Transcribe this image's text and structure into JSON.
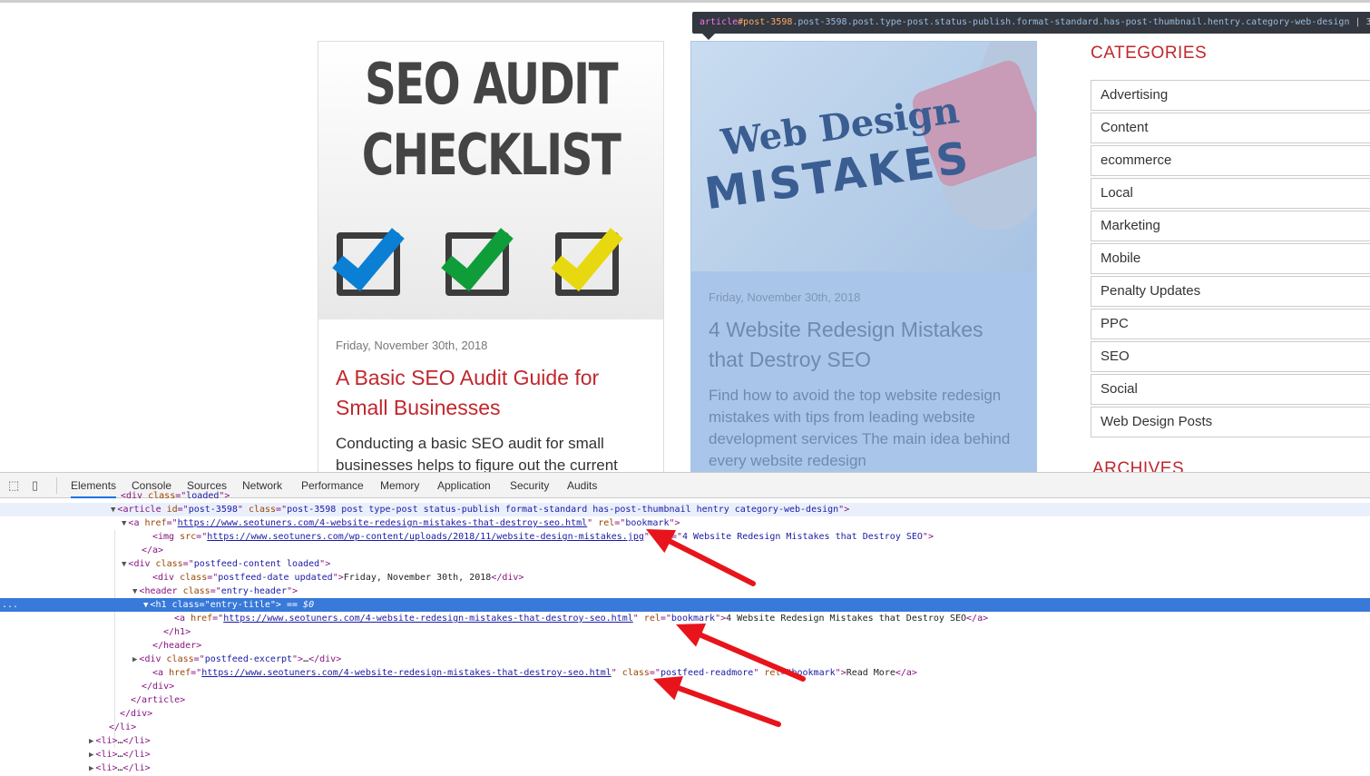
{
  "tooltip": {
    "tag": "article",
    "id": "#post-3598",
    "classes": ".post-3598.post.type-post.status-publish.format-standard.has-post-thumbnail.hentry.category-web-design",
    "extra": "| 3"
  },
  "cards": [
    {
      "image_text": [
        "SEO AUDIT",
        "CHECKLIST"
      ],
      "checkbox_colors": [
        "#0a7fd4",
        "#0f9d3a",
        "#e8d80f"
      ],
      "date": "Friday, November 30th, 2018",
      "title": "A Basic SEO Audit Guide for Small Businesses",
      "excerpt": "Conducting a basic SEO audit for small businesses helps to figure out the current"
    },
    {
      "image_text": [
        "Web Design",
        "MISTAKES"
      ],
      "date": "Friday, November 30th, 2018",
      "title": "4 Website Redesign Mistakes that Destroy SEO",
      "excerpt": "Find how to avoid the top website redesign mistakes with tips from leading website development services The main idea behind every website redesign",
      "highlighted": true
    }
  ],
  "sidebar": {
    "categories_title": "CATEGORIES",
    "categories": [
      "Advertising",
      "Content",
      "ecommerce",
      "Local",
      "Marketing",
      "Mobile",
      "Penalty Updates",
      "PPC",
      "SEO",
      "Social",
      "Web Design Posts"
    ],
    "archives_title": "ARCHIVES"
  },
  "devtools": {
    "tabs": [
      "Elements",
      "Console",
      "Sources",
      "Network",
      "Performance",
      "Memory",
      "Application",
      "Security",
      "Audits"
    ],
    "active_tab": "Elements",
    "selected_marker": "...",
    "lines": [
      {
        "indent": 122,
        "tokens": [
          [
            "tg",
            "<div "
          ],
          [
            "at",
            "class"
          ],
          [
            "tg",
            "=\""
          ],
          [
            "vl",
            "loaded"
          ],
          [
            "tg",
            "\">"
          ]
        ]
      },
      {
        "indent": 122,
        "tri": "▼",
        "hover": true,
        "tokens": [
          [
            "tg",
            "<article "
          ],
          [
            "at",
            "id"
          ],
          [
            "tg",
            "=\""
          ],
          [
            "vl",
            "post-3598"
          ],
          [
            "tg",
            "\" "
          ],
          [
            "at",
            "class"
          ],
          [
            "tg",
            "=\""
          ],
          [
            "vl",
            "post-3598 post type-post status-publish format-standard has-post-thumbnail hentry category-web-design"
          ],
          [
            "tg",
            "\">"
          ]
        ]
      },
      {
        "indent": 134,
        "tri": "▼",
        "tokens": [
          [
            "tg",
            "<a "
          ],
          [
            "at",
            "href"
          ],
          [
            "tg",
            "=\""
          ],
          [
            "lk",
            "https://www.seotuners.com/4-website-redesign-mistakes-that-destroy-seo.html"
          ],
          [
            "tg",
            "\" "
          ],
          [
            "at",
            "rel"
          ],
          [
            "tg",
            "=\""
          ],
          [
            "vl",
            "bookmark"
          ],
          [
            "tg",
            "\">"
          ]
        ]
      },
      {
        "indent": 157,
        "tokens": [
          [
            "tg",
            "<img "
          ],
          [
            "at",
            "src"
          ],
          [
            "tg",
            "=\""
          ],
          [
            "lk",
            "https://www.seotuners.com/wp-content/uploads/2018/11/website-design-mistakes.jpg"
          ],
          [
            "tg",
            "\" "
          ],
          [
            "at",
            "alt"
          ],
          [
            "tg",
            "=\""
          ],
          [
            "vl",
            "4 Website Redesign Mistakes that Destroy SEO"
          ],
          [
            "tg",
            "\">"
          ]
        ]
      },
      {
        "indent": 145,
        "tokens": [
          [
            "tg",
            "</a>"
          ]
        ]
      },
      {
        "indent": 134,
        "tri": "▼",
        "tokens": [
          [
            "tg",
            "<div "
          ],
          [
            "at",
            "class"
          ],
          [
            "tg",
            "=\""
          ],
          [
            "vl",
            "postfeed-content loaded"
          ],
          [
            "tg",
            "\">"
          ]
        ]
      },
      {
        "indent": 157,
        "tokens": [
          [
            "tg",
            "<div "
          ],
          [
            "at",
            "class"
          ],
          [
            "tg",
            "=\""
          ],
          [
            "vl",
            "postfeed-date updated"
          ],
          [
            "tg",
            "\">"
          ],
          [
            "tx",
            "Friday, November 30th, 2018"
          ],
          [
            "tg",
            "</div>"
          ]
        ]
      },
      {
        "indent": 146,
        "tri": "▼",
        "tokens": [
          [
            "tg",
            "<header "
          ],
          [
            "at",
            "class"
          ],
          [
            "tg",
            "=\""
          ],
          [
            "vl",
            "entry-header"
          ],
          [
            "tg",
            "\">"
          ]
        ]
      },
      {
        "indent": 158,
        "tri": "▼",
        "selected": true,
        "tokens": [
          [
            "tg",
            "<h1 "
          ],
          [
            "at",
            "class"
          ],
          [
            "tg",
            "=\""
          ],
          [
            "vl",
            "entry-title"
          ],
          [
            "tg",
            "\">"
          ],
          [
            "tx",
            " == "
          ],
          [
            "dl",
            "$0"
          ]
        ]
      },
      {
        "indent": 181,
        "tokens": [
          [
            "tg",
            "<a "
          ],
          [
            "at",
            "href"
          ],
          [
            "tg",
            "=\""
          ],
          [
            "lk",
            "https://www.seotuners.com/4-website-redesign-mistakes-that-destroy-seo.html"
          ],
          [
            "tg",
            "\" "
          ],
          [
            "at",
            "rel"
          ],
          [
            "tg",
            "=\""
          ],
          [
            "vl",
            "bookmark"
          ],
          [
            "tg",
            "\">"
          ],
          [
            "tx",
            "4 Website Redesign Mistakes that Destroy SEO"
          ],
          [
            "tg",
            "</a>"
          ]
        ]
      },
      {
        "indent": 169,
        "tokens": [
          [
            "tg",
            "</h1>"
          ]
        ]
      },
      {
        "indent": 157,
        "tokens": [
          [
            "tg",
            "</header>"
          ]
        ]
      },
      {
        "indent": 146,
        "tri": "▶",
        "tokens": [
          [
            "tg",
            "<div "
          ],
          [
            "at",
            "class"
          ],
          [
            "tg",
            "=\""
          ],
          [
            "vl",
            "postfeed-excerpt"
          ],
          [
            "tg",
            "\">"
          ],
          [
            "tx",
            "…"
          ],
          [
            "tg",
            "</div>"
          ]
        ]
      },
      {
        "indent": 157,
        "tokens": [
          [
            "tg",
            "<a "
          ],
          [
            "at",
            "href"
          ],
          [
            "tg",
            "=\""
          ],
          [
            "lk",
            "https://www.seotuners.com/4-website-redesign-mistakes-that-destroy-seo.html"
          ],
          [
            "tg",
            "\" "
          ],
          [
            "at",
            "class"
          ],
          [
            "tg",
            "=\""
          ],
          [
            "vl",
            "postfeed-readmore"
          ],
          [
            "tg",
            "\" "
          ],
          [
            "at",
            "rel"
          ],
          [
            "tg",
            "=\""
          ],
          [
            "vl",
            "bookmark"
          ],
          [
            "tg",
            "\">"
          ],
          [
            "tx",
            "Read More"
          ],
          [
            "tg",
            "</a>"
          ]
        ]
      },
      {
        "indent": 145,
        "tokens": [
          [
            "tg",
            "</div>"
          ]
        ]
      },
      {
        "indent": 133,
        "tokens": [
          [
            "tg",
            "</article>"
          ]
        ]
      },
      {
        "indent": 121,
        "tokens": [
          [
            "tg",
            "</div>"
          ]
        ]
      },
      {
        "indent": 109,
        "tokens": [
          [
            "tg",
            "</li>"
          ]
        ]
      },
      {
        "indent": 98,
        "tri": "▶",
        "tokens": [
          [
            "tg",
            "<li>"
          ],
          [
            "tx",
            "…"
          ],
          [
            "tg",
            "</li>"
          ]
        ]
      },
      {
        "indent": 98,
        "tri": "▶",
        "tokens": [
          [
            "tg",
            "<li>"
          ],
          [
            "tx",
            "…"
          ],
          [
            "tg",
            "</li>"
          ]
        ]
      },
      {
        "indent": 98,
        "tri": "▶",
        "tokens": [
          [
            "tg",
            "<li>"
          ],
          [
            "tx",
            "…"
          ],
          [
            "tg",
            "</li>"
          ]
        ]
      }
    ]
  },
  "annotation_color": "#e8141b"
}
